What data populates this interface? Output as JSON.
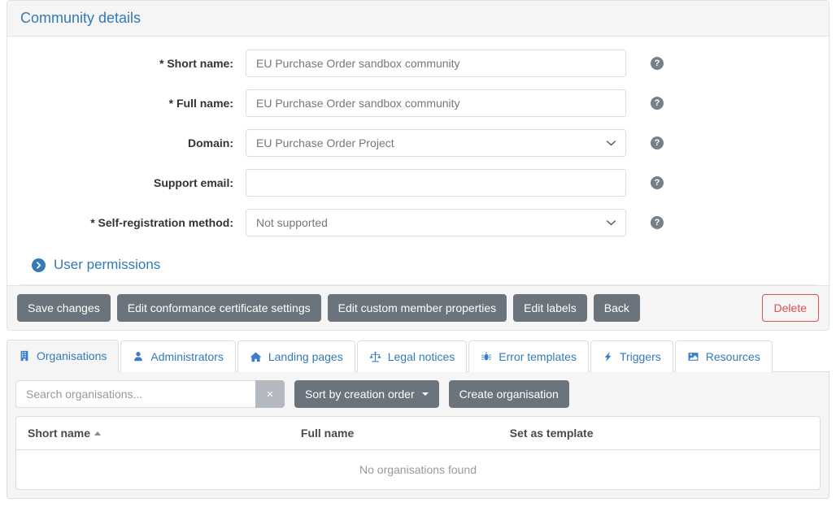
{
  "panel": {
    "title": "Community details",
    "form": {
      "fields": [
        {
          "label": "* Short name:",
          "type": "text",
          "value": "EU Purchase Order sandbox community",
          "name": "short-name"
        },
        {
          "label": "* Full name:",
          "type": "text",
          "value": "EU Purchase Order sandbox community",
          "name": "full-name"
        },
        {
          "label": "Domain:",
          "type": "select",
          "value": "EU Purchase Order Project",
          "name": "domain"
        },
        {
          "label": "Support email:",
          "type": "text",
          "value": "",
          "name": "support-email"
        },
        {
          "label": "* Self-registration method:",
          "type": "select",
          "value": "Not supported",
          "name": "self-registration-method"
        }
      ],
      "help_icon_glyph": "?",
      "help_icon_name": "help-circle-icon"
    },
    "collapsible": {
      "label": "User permissions",
      "icon": "chevron-right-circle-icon"
    },
    "footer": {
      "buttons": [
        {
          "label": "Save changes",
          "style": "secondary",
          "name": "save-changes-button"
        },
        {
          "label": "Edit conformance certificate settings",
          "style": "secondary",
          "name": "edit-conformance-certificate-settings-button"
        },
        {
          "label": "Edit custom member properties",
          "style": "secondary",
          "name": "edit-custom-member-properties-button"
        },
        {
          "label": "Edit labels",
          "style": "secondary",
          "name": "edit-labels-button"
        },
        {
          "label": "Back",
          "style": "secondary",
          "name": "back-button"
        }
      ],
      "delete_label": "Delete"
    }
  },
  "tabs": [
    {
      "label": "Organisations",
      "icon": "building-icon",
      "active": true
    },
    {
      "label": "Administrators",
      "icon": "user-icon",
      "active": false
    },
    {
      "label": "Landing pages",
      "icon": "home-icon",
      "active": false
    },
    {
      "label": "Legal notices",
      "icon": "scales-icon",
      "active": false
    },
    {
      "label": "Error templates",
      "icon": "bug-icon",
      "active": false
    },
    {
      "label": "Triggers",
      "icon": "bolt-icon",
      "active": false
    },
    {
      "label": "Resources",
      "icon": "image-icon",
      "active": false
    }
  ],
  "organisations_tab": {
    "search": {
      "placeholder": "Search organisations...",
      "value": "",
      "clear_glyph": "×"
    },
    "sort_button": "Sort by creation order",
    "create_button": "Create organisation",
    "table": {
      "columns": [
        "Short name",
        "Full name",
        "Set as template"
      ],
      "sorted_column_index": 0,
      "sort_direction": "asc",
      "rows": [],
      "empty_message": "No organisations found"
    }
  },
  "colors": {
    "link_blue": "#337ab7",
    "icon_blue": "#3b7dc6",
    "button_grey": "#6b747c",
    "danger_red": "#d9534f",
    "panel_header_bg": "#f5f5f5",
    "border": "#dddddd"
  }
}
